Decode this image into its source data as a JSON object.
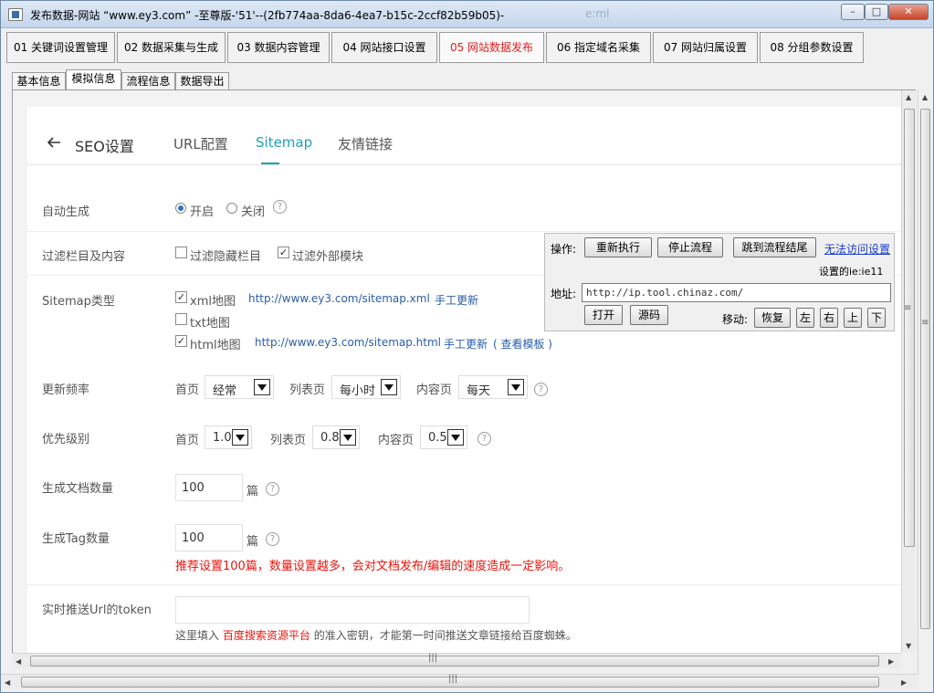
{
  "window": {
    "title": "发布数据-网站 “www.ey3.com” -至尊版-'51'--(2fb774aa-8da6-4ea7-b15c-2ccf82b59b05)-",
    "ghost_text": "e:ml",
    "min_label": "–",
    "max_label": "□",
    "close_label": "✕"
  },
  "main_tabs": [
    {
      "label": "01 关键词设置管理",
      "active": false
    },
    {
      "label": "02 数据采集与生成",
      "active": false
    },
    {
      "label": "03 数据内容管理",
      "active": false
    },
    {
      "label": "04 网站接口设置",
      "active": false
    },
    {
      "label": "05 网站数据发布",
      "active": true
    },
    {
      "label": "06 指定域名采集",
      "active": false
    },
    {
      "label": "07 网站归属设置",
      "active": false
    },
    {
      "label": "08 分组参数设置",
      "active": false
    }
  ],
  "sub_tabs": [
    {
      "label": "基本信息",
      "active": false
    },
    {
      "label": "模拟信息",
      "active": true
    },
    {
      "label": "流程信息",
      "active": false
    },
    {
      "label": "数据导出",
      "active": false
    }
  ],
  "seo_nav": {
    "title": "SEO设置",
    "tabs": [
      "URL配置",
      "Sitemap",
      "友情链接"
    ],
    "active_tab": "Sitemap"
  },
  "form": {
    "auto_generate": {
      "label": "自动生成",
      "options": [
        "开启",
        "关闭"
      ],
      "selected": "开启"
    },
    "filter": {
      "label": "过滤栏目及内容",
      "options": [
        {
          "label": "过滤隐藏栏目",
          "checked": false
        },
        {
          "label": "过滤外部模块",
          "checked": true
        }
      ]
    },
    "sitemap_type": {
      "label": "Sitemap类型",
      "xml": {
        "label": "xml地图",
        "checked": true,
        "url": "http://www.ey3.com/sitemap.xml",
        "action": "手工更新"
      },
      "txt": {
        "label": "txt地图",
        "checked": false
      },
      "html": {
        "label": "html地图",
        "checked": true,
        "url": "http://www.ey3.com/sitemap.html",
        "action": "手工更新",
        "template": "( 查看模板 )"
      }
    },
    "frequency": {
      "label": "更新频率",
      "home_label": "首页",
      "home_value": "经常",
      "list_label": "列表页",
      "list_value": "每小时",
      "content_label": "内容页",
      "content_value": "每天"
    },
    "priority": {
      "label": "优先级别",
      "home_label": "首页",
      "home_value": "1.0",
      "list_label": "列表页",
      "list_value": "0.8",
      "content_label": "内容页",
      "content_value": "0.5"
    },
    "doc_count": {
      "label": "生成文档数量",
      "value": "100",
      "unit": "篇"
    },
    "tag_count": {
      "label": "生成Tag数量",
      "value": "100",
      "unit": "篇",
      "warning": "推荐设置100篇，数量设置越多，会对文档发布/编辑的速度造成一定影响。"
    },
    "push_token": {
      "label": "实时推送Url的token",
      "value": "",
      "hint_prefix": "这里填入",
      "hint_link": "百度搜索资源平台",
      "hint_suffix": "的准入密钥，才能第一时间推送文章链接给百度蜘蛛。"
    }
  },
  "op_panel": {
    "op_label": "操作:",
    "buttons": [
      "重新执行",
      "停止流程",
      "跳到流程结尾"
    ],
    "link": "无法访问设置",
    "ie_setting": "设置的ie:ie11",
    "addr_label": "地址:",
    "addr_value": "http://ip.tool.chinaz.com/",
    "open_button": "打开",
    "source_button": "源码",
    "move_label": "移动:",
    "move_buttons": [
      "恢复",
      "左",
      "右",
      "上",
      "下"
    ]
  },
  "colors": {
    "active_tab_text": "#e02020",
    "sitemap_accent": "#1e9fb8",
    "link_blue": "#2a5da8",
    "warning_red": "#e8140c"
  }
}
